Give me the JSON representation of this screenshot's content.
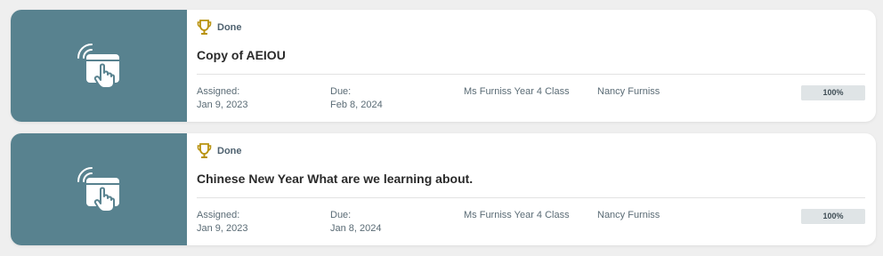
{
  "colors": {
    "thumb_bg": "#58828f",
    "trophy": "#b8920e",
    "card_bg": "#ffffff",
    "progress_track": "#dfe4e6"
  },
  "icons": {
    "thumb": "tap-screen-icon",
    "status": "trophy-icon"
  },
  "assignments": [
    {
      "status": "Done",
      "title": "Copy of AEIOU",
      "assigned_label": "Assigned:",
      "assigned_date": "Jan 9, 2023",
      "due_label": "Due:",
      "due_date": "Feb 8, 2024",
      "class_name": "Ms Furniss Year 4 Class",
      "teacher": "Nancy Furniss",
      "progress_percent": 100,
      "progress_label": "100%"
    },
    {
      "status": "Done",
      "title": "Chinese New Year What are we learning about.",
      "assigned_label": "Assigned:",
      "assigned_date": "Jan 9, 2023",
      "due_label": "Due:",
      "due_date": "Jan 8, 2024",
      "class_name": "Ms Furniss Year 4 Class",
      "teacher": "Nancy Furniss",
      "progress_percent": 100,
      "progress_label": "100%"
    }
  ]
}
